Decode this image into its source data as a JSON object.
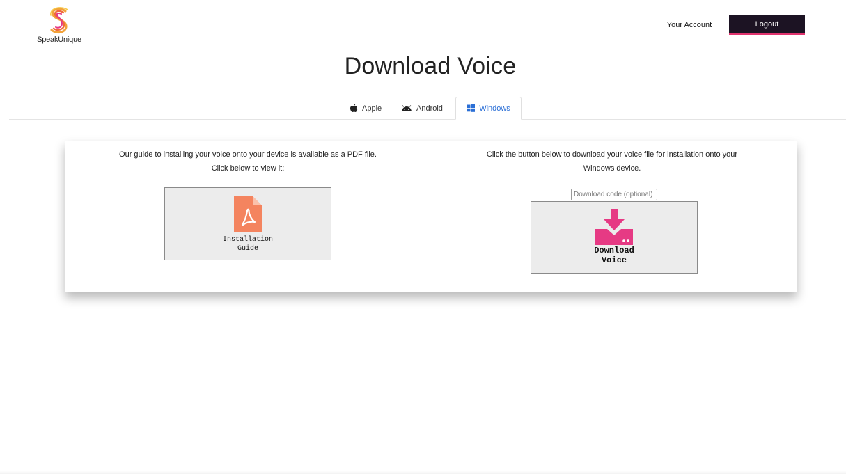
{
  "header": {
    "logo_text": "SpeakUnique",
    "account_label": "Your Account",
    "logout_label": "Logout"
  },
  "page": {
    "title": "Download Voice"
  },
  "tabs": [
    {
      "label": "Apple",
      "icon": "apple-icon",
      "active": false
    },
    {
      "label": "Android",
      "icon": "android-icon",
      "active": false
    },
    {
      "label": "Windows",
      "icon": "windows-icon",
      "active": true
    }
  ],
  "guide": {
    "line1": "Our guide to installing your voice onto your device is available as a PDF file.",
    "line2": "Click below to view it:",
    "button_line1": "Installation",
    "button_line2": "Guide",
    "icon": "pdf-file-icon"
  },
  "download": {
    "line1": "Click the button below to download your voice file for installation onto your",
    "line2": "Windows device.",
    "code_placeholder": "Download code (optional)",
    "code_value": "",
    "button_line1": "Download",
    "button_line2": "Voice",
    "icon": "download-icon"
  },
  "colors": {
    "accent_pink": "#e63a84",
    "pdf_orange": "#f4845f",
    "card_border": "#f3a07d",
    "logout_bg": "#1c1323",
    "windows_tab": "#2b6fd6"
  }
}
